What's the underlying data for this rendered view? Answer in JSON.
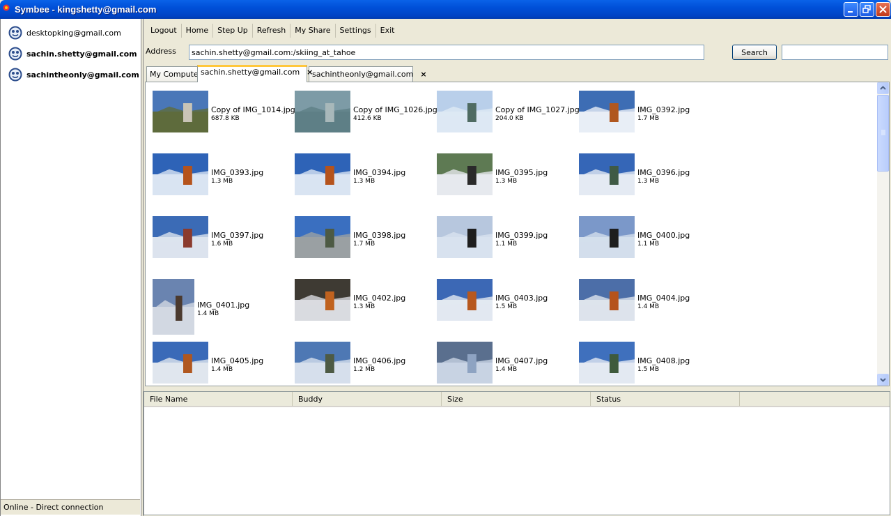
{
  "window": {
    "title": "Symbee - kingshetty@gmail.com"
  },
  "buddies": [
    {
      "email": "desktopking@gmail.com",
      "bold": false
    },
    {
      "email": "sachin.shetty@gmail.com",
      "bold": true
    },
    {
      "email": "sachintheonly@gmail.com",
      "bold": true
    }
  ],
  "status": {
    "text": "Online - Direct connection"
  },
  "toolbar": {
    "logout": "Logout",
    "home": "Home",
    "step_up": "Step Up",
    "refresh": "Refresh",
    "my_share": "My Share",
    "settings": "Settings",
    "exit": "Exit"
  },
  "address": {
    "label": "Address",
    "value": "sachin.shetty@gmail.com:/skiing_at_tahoe",
    "search_label": "Search",
    "search_value": ""
  },
  "tabs": [
    {
      "label": "My Computer",
      "closable": false,
      "active": false
    },
    {
      "label": "sachin.shetty@gmail.com",
      "closable": true,
      "active": true,
      "close": "×"
    },
    {
      "label": "sachintheonly@gmail.com",
      "closable": true,
      "active": false,
      "close": "×"
    }
  ],
  "files": [
    {
      "name": "Copy of IMG_1014.jpg",
      "size": "687.8 KB",
      "colors": [
        "#4A77B8",
        "#5E6B3C",
        "#C9C4B6"
      ],
      "portrait": false
    },
    {
      "name": "Copy of IMG_1026.jpg",
      "size": "412.6 KB",
      "colors": [
        "#7D9BA6",
        "#5E7F86",
        "#A8B8BA"
      ],
      "portrait": false
    },
    {
      "name": "Copy of IMG_1027.jpg",
      "size": "204.0 KB",
      "colors": [
        "#B9CFEA",
        "#DDE8F4",
        "#4F6B62"
      ],
      "portrait": false
    },
    {
      "name": "IMG_0392.jpg",
      "size": "1.7 MB",
      "colors": [
        "#3D6DB4",
        "#E8EEF6",
        "#B0571F"
      ],
      "portrait": false
    },
    {
      "name": "IMG_0393.jpg",
      "size": "1.3 MB",
      "colors": [
        "#2E63B7",
        "#D9E4F2",
        "#B5531C"
      ],
      "portrait": false
    },
    {
      "name": "IMG_0394.jpg",
      "size": "1.3 MB",
      "colors": [
        "#2E63B7",
        "#D9E4F2",
        "#B5531C"
      ],
      "portrait": false
    },
    {
      "name": "IMG_0395.jpg",
      "size": "1.3 MB",
      "colors": [
        "#5E7A53",
        "#E6E9EE",
        "#2A2A2A"
      ],
      "portrait": false
    },
    {
      "name": "IMG_0396.jpg",
      "size": "1.3 MB",
      "colors": [
        "#3566B7",
        "#E4EAF3",
        "#3F5A45"
      ],
      "portrait": false
    },
    {
      "name": "IMG_0397.jpg",
      "size": "1.6 MB",
      "colors": [
        "#3B6BB6",
        "#DCE3EE",
        "#8B3B2E"
      ],
      "portrait": false
    },
    {
      "name": "IMG_0398.jpg",
      "size": "1.7 MB",
      "colors": [
        "#3A6FC0",
        "#9AA0A3",
        "#4D5A44"
      ],
      "portrait": false
    },
    {
      "name": "IMG_0399.jpg",
      "size": "1.1 MB",
      "colors": [
        "#B7C7DE",
        "#D8E2EF",
        "#1E1E1E"
      ],
      "portrait": false
    },
    {
      "name": "IMG_0400.jpg",
      "size": "1.1 MB",
      "colors": [
        "#7B98C9",
        "#D3DEEC",
        "#1E1E1E"
      ],
      "portrait": false
    },
    {
      "name": "IMG_0401.jpg",
      "size": "1.4 MB",
      "colors": [
        "#6A84B0",
        "#D2D8E2",
        "#4B3A2F"
      ],
      "portrait": true
    },
    {
      "name": "IMG_0402.jpg",
      "size": "1.3 MB",
      "colors": [
        "#3E3A33",
        "#D9DBE0",
        "#C0621F"
      ],
      "portrait": false
    },
    {
      "name": "IMG_0403.jpg",
      "size": "1.5 MB",
      "colors": [
        "#3C68B5",
        "#E2E8F1",
        "#B7581E"
      ],
      "portrait": false
    },
    {
      "name": "IMG_0404.jpg",
      "size": "1.4 MB",
      "colors": [
        "#4C6EA8",
        "#DDE3EC",
        "#B5531C"
      ],
      "portrait": false
    },
    {
      "name": "IMG_0405.jpg",
      "size": "1.4 MB",
      "colors": [
        "#3A6AB8",
        "#E0E6EE",
        "#B0571F"
      ],
      "portrait": false
    },
    {
      "name": "IMG_0406.jpg",
      "size": "1.2 MB",
      "colors": [
        "#4E78B4",
        "#D6DFEC",
        "#4D5A44"
      ],
      "portrait": false
    },
    {
      "name": "IMG_0407.jpg",
      "size": "1.4 MB",
      "colors": [
        "#5A6F8E",
        "#C8D3E3",
        "#8EA3C2"
      ],
      "portrait": false
    },
    {
      "name": "IMG_0408.jpg",
      "size": "1.5 MB",
      "colors": [
        "#3F70BD",
        "#E3E9F2",
        "#3E5A3C"
      ],
      "portrait": false
    }
  ],
  "transfers": {
    "columns": [
      "File Name",
      "Buddy",
      "Size",
      "Status"
    ],
    "rows": []
  }
}
